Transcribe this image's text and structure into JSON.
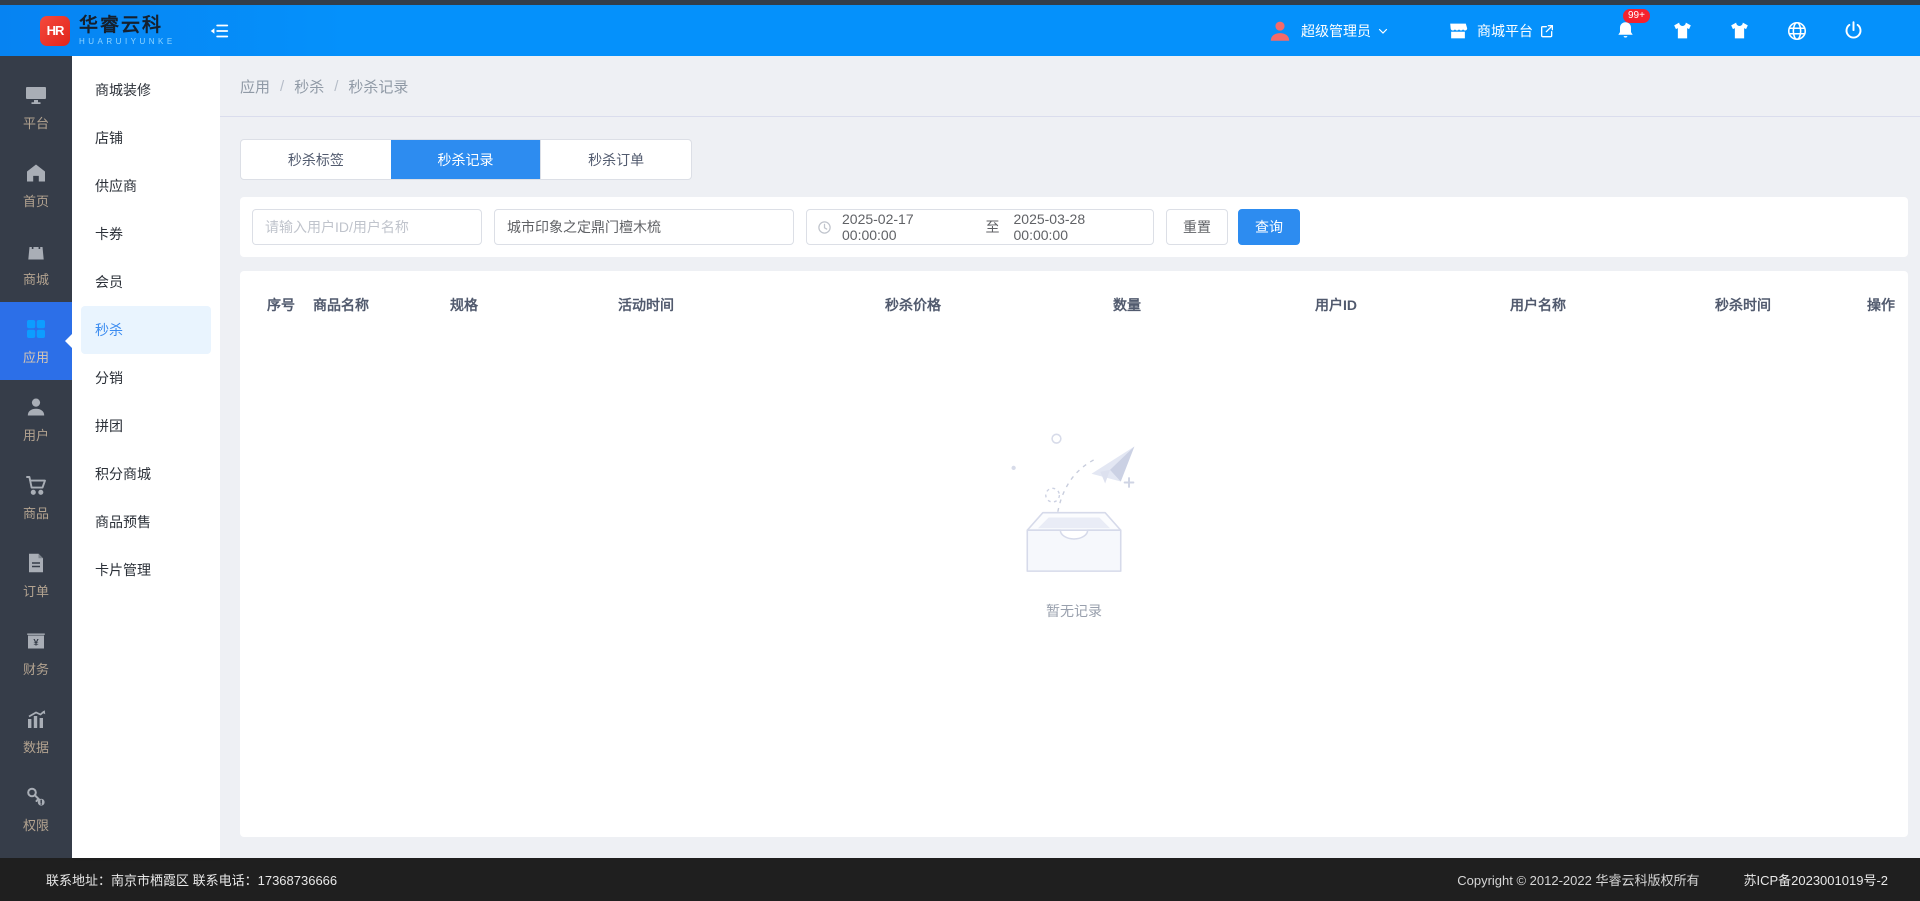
{
  "colors": {
    "topbar": "#0591fb",
    "sidebar_bg": "#363d49",
    "sidebar_active_bg": "#2c6fe8",
    "accent_blue": "#2d8cf0",
    "badge_red": "#f5222d",
    "footer_bg": "#1f1f1f"
  },
  "header": {
    "logo": {
      "monogram": "HR",
      "name": "华睿云科",
      "subtitle": "HUARUIYUNKE"
    },
    "user": {
      "name": "超级管理员"
    },
    "platform": {
      "name": "商城平台"
    },
    "notifications": {
      "badge": "99+"
    }
  },
  "sidebar": {
    "items": [
      {
        "label": "平台",
        "icon": "monitor-icon",
        "active": false
      },
      {
        "label": "首页",
        "icon": "home-icon",
        "active": false
      },
      {
        "label": "商城",
        "icon": "bag-icon",
        "active": false
      },
      {
        "label": "应用",
        "icon": "grid-icon",
        "active": true
      },
      {
        "label": "用户",
        "icon": "user-icon",
        "active": false
      },
      {
        "label": "商品",
        "icon": "cart-icon",
        "active": false
      },
      {
        "label": "订单",
        "icon": "file-icon",
        "active": false
      },
      {
        "label": "财务",
        "icon": "wallet-icon",
        "active": false
      },
      {
        "label": "数据",
        "icon": "chart-icon",
        "active": false
      },
      {
        "label": "权限",
        "icon": "key-icon",
        "active": false
      }
    ]
  },
  "submenu": {
    "items": [
      {
        "label": "商城装修",
        "active": false
      },
      {
        "label": "店铺",
        "active": false
      },
      {
        "label": "供应商",
        "active": false
      },
      {
        "label": "卡券",
        "active": false
      },
      {
        "label": "会员",
        "active": false
      },
      {
        "label": "秒杀",
        "active": true
      },
      {
        "label": "分销",
        "active": false
      },
      {
        "label": "拼团",
        "active": false
      },
      {
        "label": "积分商城",
        "active": false
      },
      {
        "label": "商品预售",
        "active": false
      },
      {
        "label": "卡片管理",
        "active": false
      }
    ]
  },
  "breadcrumb": {
    "items": [
      "应用",
      "秒杀",
      "秒杀记录"
    ],
    "separator": "/"
  },
  "tabs": [
    {
      "label": "秒杀标签",
      "active": false
    },
    {
      "label": "秒杀记录",
      "active": true
    },
    {
      "label": "秒杀订单",
      "active": false
    }
  ],
  "filters": {
    "user_input": {
      "placeholder": "请输入用户ID/用户名称",
      "value": ""
    },
    "product_input": {
      "value": "城市印象之定鼎门檀木梳"
    },
    "date_range": {
      "start": "2025-02-17 00:00:00",
      "separator": "至",
      "end": "2025-03-28 00:00:00"
    },
    "reset_label": "重置",
    "search_label": "查询"
  },
  "table": {
    "columns": [
      "序号",
      "商品名称",
      "规格",
      "活动时间",
      "秒杀价格",
      "数量",
      "用户ID",
      "用户名称",
      "秒杀时间",
      "操作"
    ],
    "rows": [],
    "empty_text": "暂无记录"
  },
  "footer": {
    "contact": "联系地址：南京市栖霞区 联系电话：17368736666",
    "copyright": "Copyright © 2012-2022 华睿云科版权所有",
    "icp": "苏ICP备2023001019号-2"
  }
}
